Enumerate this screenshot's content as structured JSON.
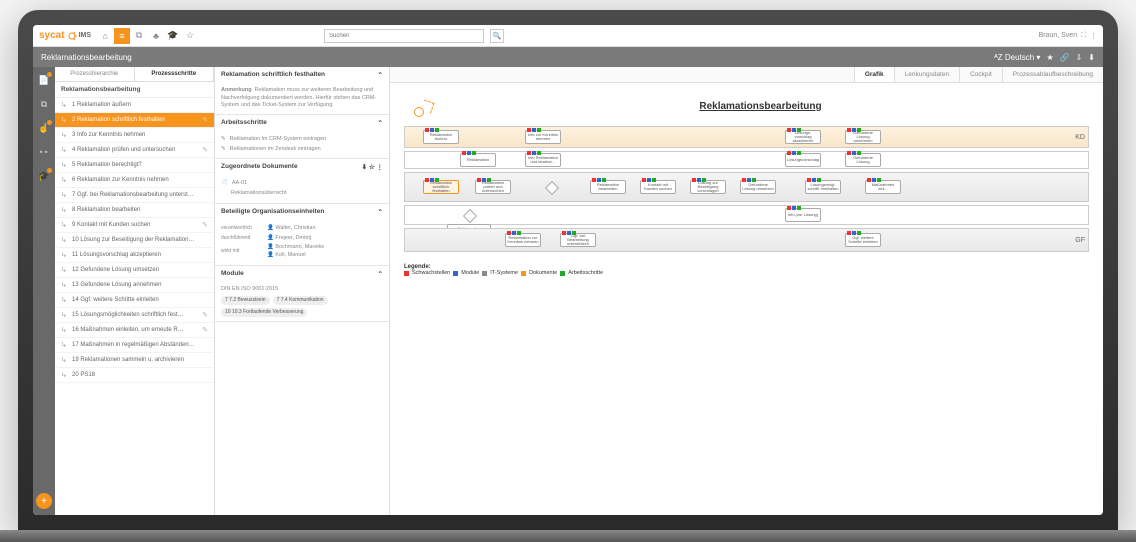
{
  "brand": {
    "name": "sycat",
    "sub": "IMS"
  },
  "search": {
    "placeholder": "Suchen"
  },
  "user": {
    "name": "Braun, Sven"
  },
  "header": {
    "title": "Reklamationsbearbeitung",
    "lang": "Deutsch"
  },
  "leftTabs": [
    "Prozesshierarchie",
    "Prozessschritte"
  ],
  "group": "Reklamationsbearbeitung",
  "steps": [
    "1 Reklamation äußern",
    "2 Reklamation schriftlich festhalten",
    "3 Info zur Kenntnis nehmen",
    "4 Reklamation prüfen und untersuchen",
    "5 Reklamation berechtigt?",
    "6 Reklamation zur Kenntnis nehmen",
    "7 Ggf. bei Reklamationsbearbeitung unterst…",
    "8 Reklamation bearbeiten",
    "9 Kontakt mit Kunden suchen",
    "10 Lösung zur Beseitigung der Reklamation…",
    "11 Lösungsvorschlag akzeptieren",
    "12 Gefundene Lösung umsetzen",
    "13 Gefundene Lösung annehmen",
    "14 Ggf. weitere Schritte einleiten",
    "15 Lösungsmöglichkeiten schriftlich fest…",
    "16 Maßnahmen einleiten, um erneute R…",
    "17 Maßnahmen in regelmäßigen Abständen…",
    "19 Reklamationen sammeln u. archivieren",
    "20 PS18"
  ],
  "selected": 1,
  "editable": [
    3,
    8,
    14,
    15
  ],
  "detail": {
    "title": "Reklamation schriftlich festhalten",
    "remarkLabel": "Anmerkung",
    "remark": "Reklamation muss zur weiteren Bearbeitung und Nachverfolgung dokumentiert werden. Hierfür stehen das CRM-System und das Ticket-System zur Verfügung.",
    "sections": {
      "arbeitsschritte": "Arbeitsschritte",
      "as_items": [
        "Reklamation im CRM-System eintragen",
        "Reklamationen im Zendesk eintragen"
      ],
      "dokumente": "Zugeordnete Dokumente",
      "doc": [
        "AA-01",
        "Reklamationsübersicht"
      ],
      "org": "Beteiligte Organisationseinheiten",
      "org_rows": [
        {
          "role": "verantwortlich",
          "people": [
            "Walter, Christian"
          ]
        },
        {
          "role": "durchführend",
          "people": [
            "Frejeer, Dmitrij"
          ]
        },
        {
          "role": "wirkt mit",
          "people": [
            "Bochmann, Mareike",
            "Koll, Manuel"
          ]
        }
      ],
      "module": "Module",
      "std": "DIN EN ISO 9001:2015",
      "tags": [
        "7",
        "7.2 Bewusstsein",
        "7",
        "7.4 Kommunikation",
        "10",
        "10.3 Fortlaufende Verbesserung"
      ]
    }
  },
  "mainTabs": [
    "Grafik",
    "Lenkungsdaten",
    "Cockpit",
    "Prozessablaufbeschreibung"
  ],
  "diagramTitle": "Reklamationsbearbeitung",
  "lanes": {
    "kd": "KD",
    "gf": "GF"
  },
  "legend": {
    "title": "Legende:",
    "items": [
      {
        "c": "#e33",
        "t": "Schwachstellen"
      },
      {
        "c": "#36c",
        "t": "Module"
      },
      {
        "c": "#888",
        "t": "IT-Systeme"
      },
      {
        "c": "#f7941e",
        "t": "Dokumente"
      },
      {
        "c": "#2a2",
        "t": "Arbeitsschritte"
      }
    ]
  },
  "nodes": {
    "kd": [
      "Reklamation äußern",
      "Info zur Kenntnis nehmen",
      "Lösungs-vorschlag akzeptieren",
      "Gefundene Lösung annehmen"
    ],
    "mid": [
      "Reklamation",
      "Info Reklamation und bearbei…",
      "Lösungsvorschlag",
      "Gefundene Lösung"
    ],
    "main": [
      "Reklamation schriftlich festhalten",
      "Reklamation prüfen und untersuchen",
      "Reklamation berechtigt?",
      "Reklamation bearbeiten",
      "Kontakt mit Kunden suchen",
      "Lösung zur Beseitigung vorschlagen",
      "Gefundene Lösung umsetzen",
      "Lösungsmögl. schriftl. festhalten",
      "Maßnahmen einl..."
    ],
    "gf": [
      "Reklamation berechtigt?",
      "Reklamation zur Kenntnis nehmen",
      "Ggf. bei Bearbeitung unterstützen",
      "Info (zur Lösung)",
      "Ggf. weitere Schritte einleiten"
    ]
  }
}
